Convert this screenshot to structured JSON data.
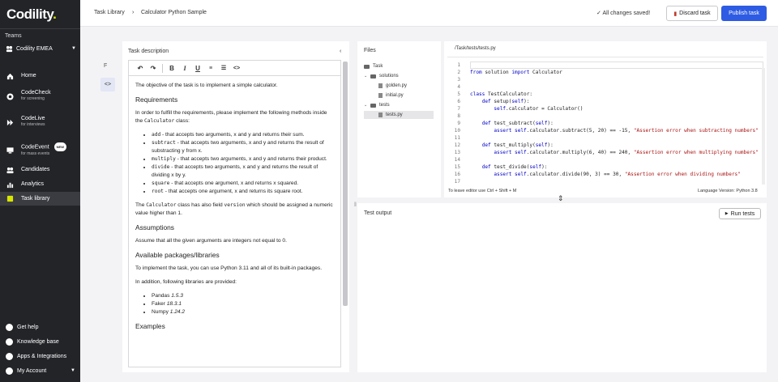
{
  "app": {
    "logo_text": "Codility",
    "logo_dot": ".",
    "accent": "#d8e500"
  },
  "sidebar": {
    "teams_label": "Teams",
    "team_name": "Codility EMEA",
    "items": [
      {
        "label": "Home",
        "sub": "",
        "icon": "home-icon"
      },
      {
        "label": "CodeCheck",
        "sub": "for screening",
        "icon": "codecheck-icon"
      },
      {
        "label": "CodeLive",
        "sub": "for interviews",
        "icon": "codelive-icon"
      },
      {
        "label": "CodeEvent",
        "sub": "for mass events",
        "icon": "codeevent-icon",
        "badge": "NEW"
      },
      {
        "label": "Candidates",
        "sub": "",
        "icon": "candidates-icon"
      },
      {
        "label": "Analytics",
        "sub": "",
        "icon": "analytics-icon"
      },
      {
        "label": "Task library",
        "sub": "",
        "icon": "task-library-icon"
      }
    ],
    "bottom": [
      {
        "label": "Get help",
        "icon": "help-icon"
      },
      {
        "label": "Knowledge base",
        "icon": "knowledge-base-icon"
      },
      {
        "label": "Apps & Integrations",
        "icon": "apps-icon"
      },
      {
        "label": "My Account",
        "icon": "account-icon"
      }
    ]
  },
  "header": {
    "breadcrumb_root": "Task Library",
    "breadcrumb_sep": "›",
    "breadcrumb_current": "Calculator Python Sample",
    "saved_status": "All changes saved!",
    "discard_label": "Discard task",
    "publish_label": "Publish task",
    "publish_color": "#2d5be3"
  },
  "description": {
    "title": "Task description",
    "p1": "The objective of the task is to implement a simple calculator.",
    "h_requirements": "Requirements",
    "p2_a": "In order to fulfill the requirements, please implement the following methods inside the ",
    "p2_code": "Calculator",
    "p2_b": " class:",
    "methods": [
      {
        "name": "add",
        "text": " - that accepts two arguments, x and y and returns their sum."
      },
      {
        "name": "subtract",
        "text": " - that accepts two arguments, x and y and returns the result of substracting y from x."
      },
      {
        "name": "multiply",
        "text": " - that accepts two arguments, x and y and returns their product."
      },
      {
        "name": "divide",
        "text": " - that accepts two arguments, x and y and returns the result of dividing x by y."
      },
      {
        "name": "square",
        "text": " - that accepts one argument, x and returns x squared."
      },
      {
        "name": "root",
        "text": " - that accepts one argument, x and returns its square root."
      }
    ],
    "p3_a": "The ",
    "p3_code1": "Calculator",
    "p3_b": " class has also field ",
    "p3_code2": "version",
    "p3_c": " which should be assigned a numeric value higher than 1.",
    "h_assumptions": "Assumptions",
    "p4": "Assume that all the given arguments are integers not equal to 0.",
    "h_packages": "Available packages/libraries",
    "p5": "To implement the task, you can use Python 3.11 and all of its built-in packages.",
    "p6": "In addition, following libraries are provided:",
    "libraries": [
      {
        "name": "Pandas ",
        "version": "1.5.3"
      },
      {
        "name": "Faker ",
        "version": "18.3.1"
      },
      {
        "name": "Numpy ",
        "version": "1.24.2"
      }
    ],
    "h_examples": "Examples"
  },
  "files": {
    "title": "Files",
    "tree": [
      {
        "label": "Task",
        "type": "folder",
        "depth": 0
      },
      {
        "label": "solutions",
        "type": "folder",
        "depth": 1
      },
      {
        "label": "golden.py",
        "type": "file",
        "depth": 2
      },
      {
        "label": "initial.py",
        "type": "file",
        "depth": 2
      },
      {
        "label": "tests",
        "type": "folder",
        "depth": 1
      },
      {
        "label": "tests.py",
        "type": "file",
        "depth": 2,
        "selected": true
      }
    ]
  },
  "editor": {
    "tab_path": "/Task/tests/tests.py",
    "hint": "To leave editor use Ctrl + Shift + M",
    "language": "Language Version: Python 3.8",
    "lines": [
      {
        "n": "1",
        "parts": []
      },
      {
        "n": "2",
        "parts": [
          {
            "t": "from",
            "c": "kw"
          },
          {
            "t": " solution ",
            "c": "fn"
          },
          {
            "t": "import",
            "c": "kw"
          },
          {
            "t": " Calculator",
            "c": "fn"
          }
        ]
      },
      {
        "n": "3",
        "parts": []
      },
      {
        "n": "4",
        "parts": []
      },
      {
        "n": "5",
        "parts": [
          {
            "t": "class",
            "c": "kw"
          },
          {
            "t": " TestCalculator:",
            "c": "fn"
          }
        ]
      },
      {
        "n": "6",
        "parts": [
          {
            "t": "    ",
            "c": "fn"
          },
          {
            "t": "def",
            "c": "kw"
          },
          {
            "t": " setup(",
            "c": "fn"
          },
          {
            "t": "self",
            "c": "kw"
          },
          {
            "t": "):",
            "c": "fn"
          }
        ]
      },
      {
        "n": "7",
        "parts": [
          {
            "t": "        ",
            "c": "fn"
          },
          {
            "t": "self",
            "c": "kw"
          },
          {
            "t": ".calculator = Calculator()",
            "c": "fn"
          }
        ]
      },
      {
        "n": "8",
        "parts": []
      },
      {
        "n": "9",
        "parts": [
          {
            "t": "    ",
            "c": "fn"
          },
          {
            "t": "def",
            "c": "kw"
          },
          {
            "t": " test_subtract(",
            "c": "fn"
          },
          {
            "t": "self",
            "c": "kw"
          },
          {
            "t": "):",
            "c": "fn"
          }
        ]
      },
      {
        "n": "10",
        "parts": [
          {
            "t": "        ",
            "c": "fn"
          },
          {
            "t": "assert",
            "c": "kw"
          },
          {
            "t": " ",
            "c": "fn"
          },
          {
            "t": "self",
            "c": "kw"
          },
          {
            "t": ".calculator.subtract(5, 20) == -15, ",
            "c": "fn"
          },
          {
            "t": "\"Assertion error when subtracting numbers\"",
            "c": "str"
          }
        ]
      },
      {
        "n": "11",
        "parts": []
      },
      {
        "n": "12",
        "parts": [
          {
            "t": "    ",
            "c": "fn"
          },
          {
            "t": "def",
            "c": "kw"
          },
          {
            "t": " test_multiply(",
            "c": "fn"
          },
          {
            "t": "self",
            "c": "kw"
          },
          {
            "t": "):",
            "c": "fn"
          }
        ]
      },
      {
        "n": "13",
        "parts": [
          {
            "t": "        ",
            "c": "fn"
          },
          {
            "t": "assert",
            "c": "kw"
          },
          {
            "t": " ",
            "c": "fn"
          },
          {
            "t": "self",
            "c": "kw"
          },
          {
            "t": ".calculator.multiply(6, 40) == 240, ",
            "c": "fn"
          },
          {
            "t": "\"Assertion error when multiplying numbers\"",
            "c": "str"
          }
        ]
      },
      {
        "n": "14",
        "parts": []
      },
      {
        "n": "15",
        "parts": [
          {
            "t": "    ",
            "c": "fn"
          },
          {
            "t": "def",
            "c": "kw"
          },
          {
            "t": " test_divide(",
            "c": "fn"
          },
          {
            "t": "self",
            "c": "kw"
          },
          {
            "t": "):",
            "c": "fn"
          }
        ]
      },
      {
        "n": "16",
        "parts": [
          {
            "t": "        ",
            "c": "fn"
          },
          {
            "t": "assert",
            "c": "kw"
          },
          {
            "t": " ",
            "c": "fn"
          },
          {
            "t": "self",
            "c": "kw"
          },
          {
            "t": ".calculator.divide(90, 3) == 30, ",
            "c": "fn"
          },
          {
            "t": "\"Assertion error when dividing numbers\"",
            "c": "str"
          }
        ]
      },
      {
        "n": "17",
        "parts": []
      }
    ]
  },
  "output": {
    "title": "Test output",
    "run_label": "Run tests"
  }
}
